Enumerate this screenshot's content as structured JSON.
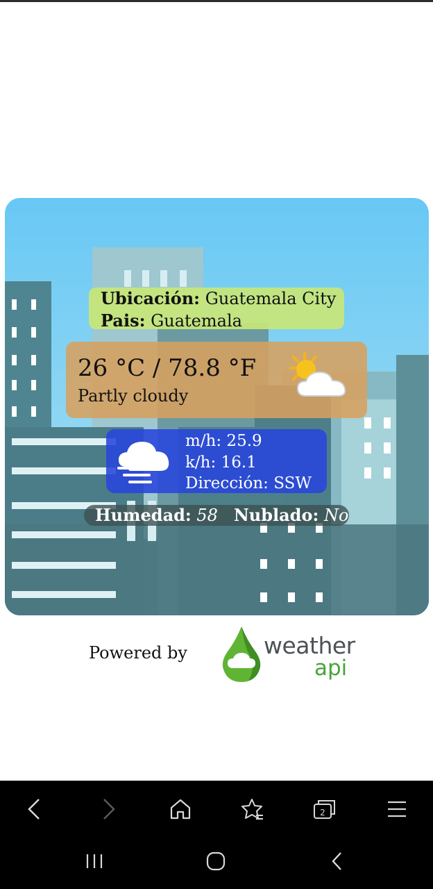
{
  "weather": {
    "location_label": "Ubicación:",
    "location_value": "Guatemala City",
    "country_label": "Pais:",
    "country_value": "Guatemala",
    "temperature": "26 °C / 78.8 °F",
    "condition": "Partly cloudy",
    "condition_icon": "partly-cloudy-icon",
    "wind_icon": "wind-icon",
    "wind_mph": "m/h: 25.9",
    "wind_kph": "k/h: 16.1",
    "wind_dir": "Dirección: SSW",
    "humidity_label": "Humedad:",
    "humidity_value": "58",
    "cloudy_label": "Nublado:",
    "cloudy_value": "No"
  },
  "footer": {
    "powered_by": "Powered by",
    "logo_word1": "weather",
    "logo_word2": "api"
  },
  "browser_toolbar": {
    "icons": [
      "back-icon",
      "forward-icon",
      "home-icon",
      "bookmarks-icon",
      "tabs-icon",
      "menu-icon"
    ],
    "tab_count": "2"
  },
  "system_nav": {
    "icons": [
      "recents-icon",
      "home-circle-icon",
      "system-back-icon"
    ]
  },
  "colors": {
    "sky": "#68c8f4",
    "location_box": "#c8e678",
    "temp_box": "#d7a05f",
    "wind_box": "#2846dc",
    "humidity_box": "#3c5050",
    "logo_green": "#48a43a"
  }
}
